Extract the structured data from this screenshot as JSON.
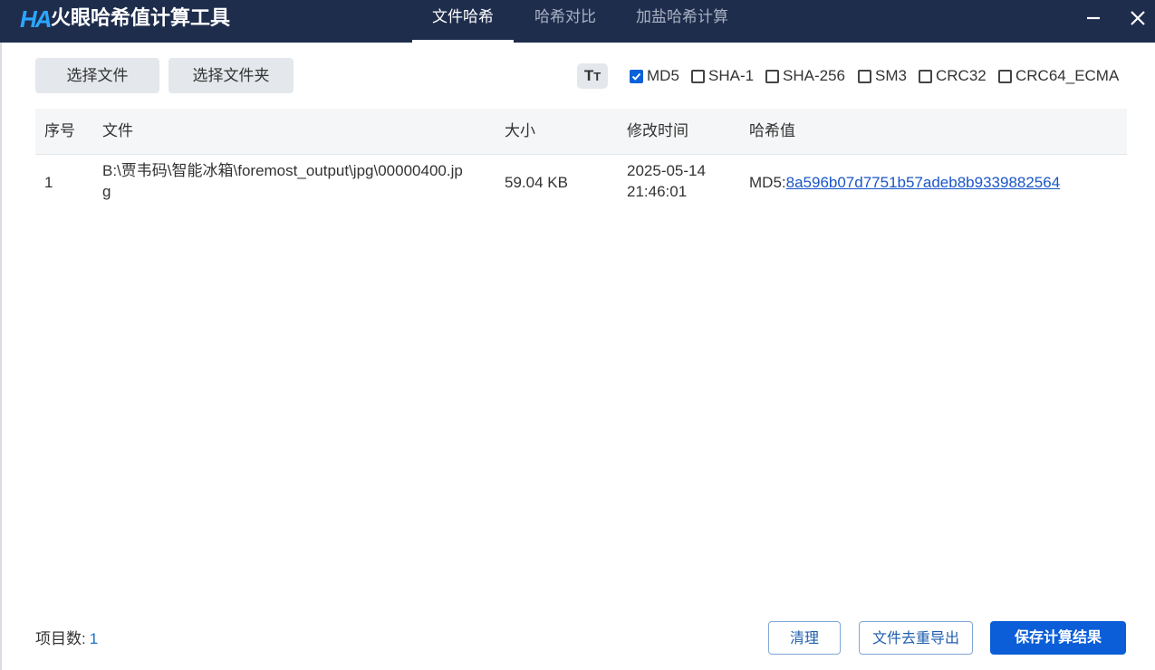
{
  "app": {
    "logo_text": "HA",
    "title": "火眼哈希值计算工具"
  },
  "tabs": [
    {
      "label": "文件哈希",
      "active": true
    },
    {
      "label": "哈希对比",
      "active": false
    },
    {
      "label": "加盐哈希计算",
      "active": false
    }
  ],
  "window_controls": {
    "minimize": "minimize-icon",
    "close": "close-icon"
  },
  "toolbar": {
    "select_file": "选择文件",
    "select_folder": "选择文件夹",
    "font_size_icon": "text-size-icon"
  },
  "algorithms": [
    {
      "label": "MD5",
      "checked": true
    },
    {
      "label": "SHA-1",
      "checked": false
    },
    {
      "label": "SHA-256",
      "checked": false
    },
    {
      "label": "SM3",
      "checked": false
    },
    {
      "label": "CRC32",
      "checked": false
    },
    {
      "label": "CRC64_ECMA",
      "checked": false
    }
  ],
  "table": {
    "columns": [
      "序号",
      "文件",
      "大小",
      "修改时间",
      "哈希值"
    ],
    "rows": [
      {
        "index": "1",
        "file_line1": "B:\\贾韦码\\智能冰箱\\foremost_output\\jpg\\00000400.jp",
        "file_line2": "g",
        "size": "59.04 KB",
        "modified_date": "2025-05-14",
        "modified_time": "21:46:01",
        "hash_prefix": "MD5:",
        "hash_value": "8a596b07d7751b57adeb8b9339882564"
      }
    ]
  },
  "footer": {
    "count_label": "项目数:",
    "count_value": "1",
    "clear": "清理",
    "dedupe_export": "文件去重导出",
    "save_results": "保存计算结果"
  },
  "colors": {
    "titlebar": "#1f2d4d",
    "primary": "#0b5ed7",
    "link": "#1a56c6"
  }
}
